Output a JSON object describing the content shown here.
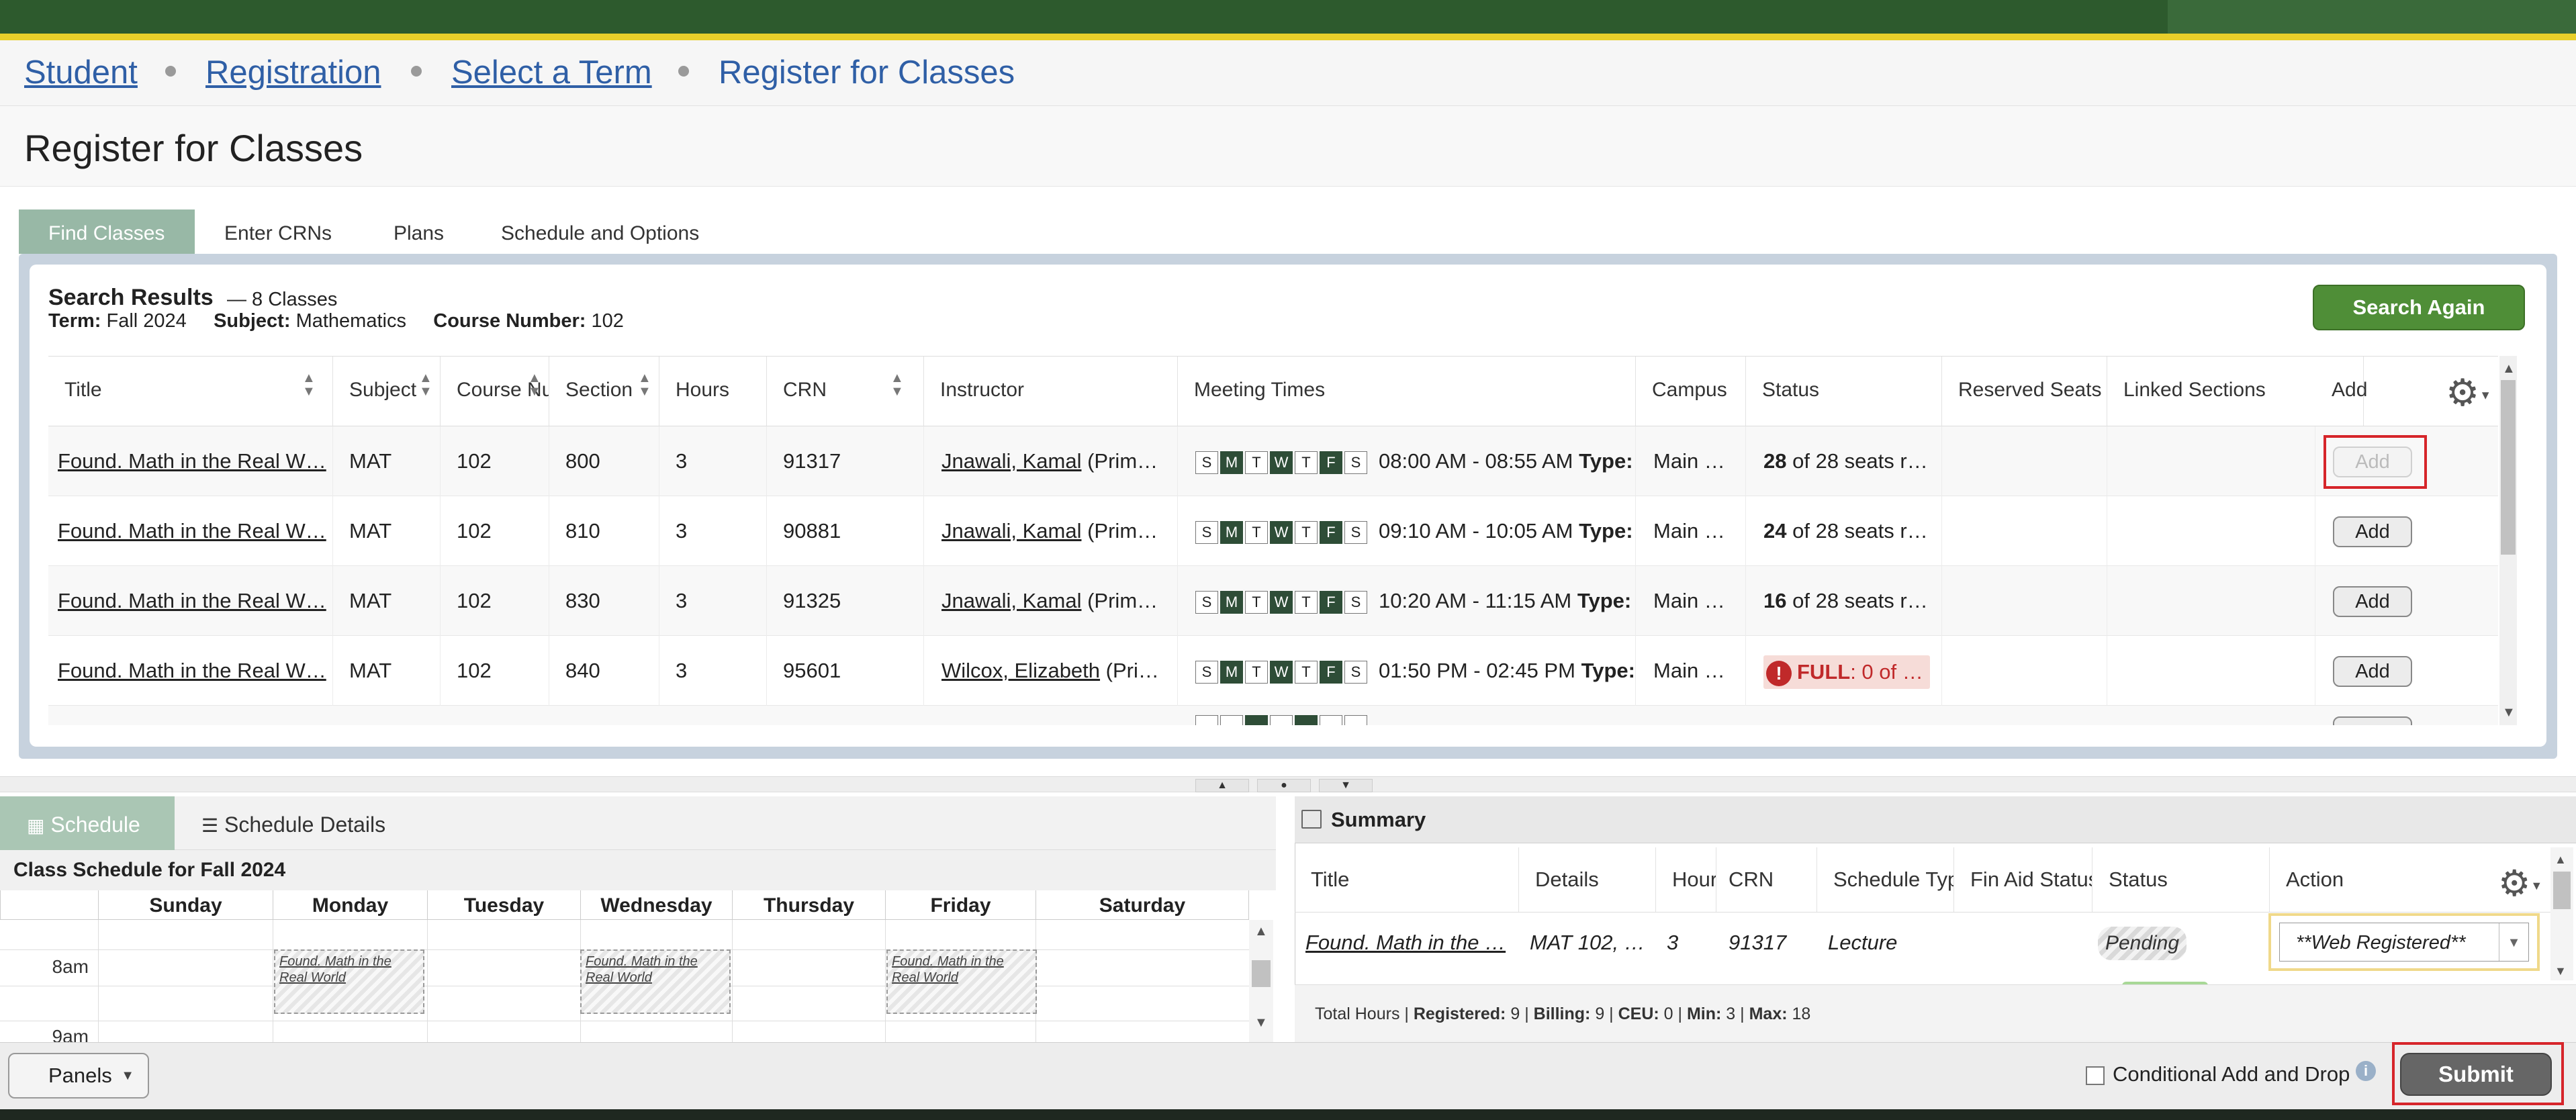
{
  "breadcrumb": {
    "student": "Student",
    "registration": "Registration",
    "select_term": "Select a Term",
    "current": "Register for Classes"
  },
  "page_title": "Register for Classes",
  "tabs": {
    "find": "Find Classes",
    "crn": "Enter CRNs",
    "plans": "Plans",
    "schedule": "Schedule and Options"
  },
  "search": {
    "title": "Search Results",
    "count": "— 8 Classes",
    "term_label": "Term:",
    "term": "Fall 2024",
    "subject_label": "Subject:",
    "subject": "Mathematics",
    "course_label": "Course Number:",
    "course": "102",
    "again": "Search Again"
  },
  "columns": {
    "title": "Title",
    "subject": "Subject",
    "course": "Course Nu",
    "section": "Section",
    "hours": "Hours",
    "crn": "CRN",
    "instructor": "Instructor",
    "meeting": "Meeting Times",
    "campus": "Campus",
    "status": "Status",
    "reserved": "Reserved Seats",
    "linked": "Linked Sections",
    "add": "Add"
  },
  "days": [
    "S",
    "M",
    "T",
    "W",
    "T",
    "F",
    "S"
  ],
  "type_label": "Type:",
  "add_label": "Add",
  "rows": [
    {
      "title": "Found. Math in the Real W…",
      "subject": "MAT",
      "course": "102",
      "section": "800",
      "hours": "3",
      "crn": "91317",
      "instructor": "Jnawali, Kamal",
      "role": "(Prim…",
      "time": "08:00 AM - 08:55 AM",
      "campus": "Main …",
      "seats": "28",
      "seats_rest": "of 28 seats r…"
    },
    {
      "title": "Found. Math in the Real W…",
      "subject": "MAT",
      "course": "102",
      "section": "810",
      "hours": "3",
      "crn": "90881",
      "instructor": "Jnawali, Kamal",
      "role": "(Prim…",
      "time": "09:10 AM - 10:05 AM",
      "campus": "Main …",
      "seats": "24",
      "seats_rest": "of 28 seats r…"
    },
    {
      "title": "Found. Math in the Real W…",
      "subject": "MAT",
      "course": "102",
      "section": "830",
      "hours": "3",
      "crn": "91325",
      "instructor": "Jnawali, Kamal",
      "role": "(Prim…",
      "time": "10:20 AM - 11:15 AM",
      "campus": "Main …",
      "seats": "16",
      "seats_rest": "of 28 seats r…"
    },
    {
      "title": "Found. Math in the Real W…",
      "subject": "MAT",
      "course": "102",
      "section": "840",
      "hours": "3",
      "crn": "95601",
      "instructor": "Wilcox, Elizabeth",
      "role": "(Pri…",
      "time": "01:50 PM - 02:45 PM",
      "campus": "Main …",
      "full": "FULL",
      "full_rest": ": 0 of …"
    }
  ],
  "schedule": {
    "tab_schedule": "Schedule",
    "tab_details": "Schedule Details",
    "title": "Class Schedule for Fall 2024",
    "days": [
      "Sunday",
      "Monday",
      "Tuesday",
      "Wednesday",
      "Thursday",
      "Friday",
      "Saturday"
    ],
    "hour_8": "8am",
    "hour_9": "9am",
    "event_title": "Found. Math in the Real World"
  },
  "summary": {
    "title": "Summary",
    "columns": {
      "title": "Title",
      "details": "Details",
      "hours": "Hour",
      "crn": "CRN",
      "type": "Schedule Typ",
      "finaid": "Fin Aid Status",
      "status": "Status",
      "action": "Action"
    },
    "row": {
      "title": "Found. Math in the …",
      "details": "MAT 102, …",
      "hours": "3",
      "crn": "91317",
      "type": "Lecture",
      "status": "Pending",
      "action": "**Web Registered**"
    },
    "totals": {
      "label": "Total Hours |",
      "reg_label": "Registered:",
      "reg": "9",
      "bill_label": "Billing:",
      "bill": "9",
      "ceu_label": "CEU:",
      "ceu": "0",
      "min_label": "Min:",
      "min": "3",
      "max_label": "Max:",
      "max": "18"
    }
  },
  "bottom": {
    "panels": "Panels",
    "conditional": "Conditional Add and Drop",
    "submit": "Submit"
  }
}
